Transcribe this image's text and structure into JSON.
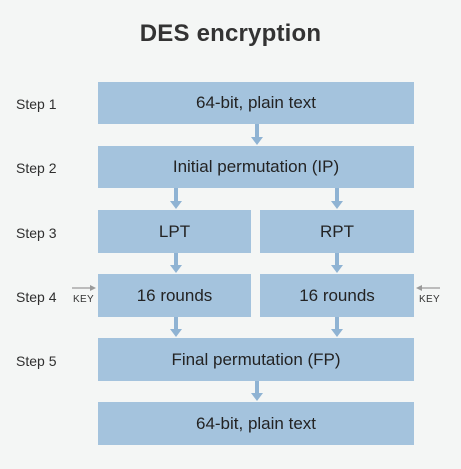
{
  "title": "DES encryption",
  "steps": [
    "Step 1",
    "Step 2",
    "Step 3",
    "Step 4",
    "Step 5"
  ],
  "boxes": {
    "plain_text_in": "64-bit, plain text",
    "initial_permutation": "Initial permutation (IP)",
    "lpt": "LPT",
    "rpt": "RPT",
    "rounds_left": "16 rounds",
    "rounds_right": "16 rounds",
    "final_permutation": "Final permutation (FP)",
    "plain_text_out": "64-bit, plain text"
  },
  "key_left": "KEY",
  "key_right": "KEY",
  "colors": {
    "box_fill": "#a4c3dd",
    "arrow": "#8fb3d3",
    "key_arrow": "#9a9a9a"
  }
}
